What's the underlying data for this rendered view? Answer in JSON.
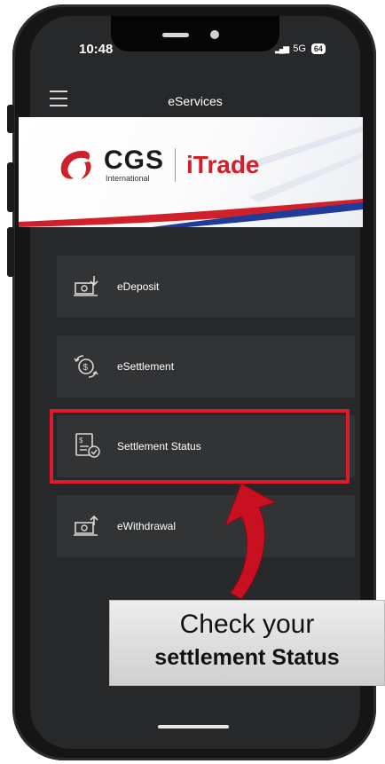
{
  "status_bar": {
    "time": "10:48",
    "network": "5G",
    "battery": "64"
  },
  "header": {
    "title": "eServices"
  },
  "banner": {
    "brand": "CGS",
    "brand_sub": "International",
    "product": "iTrade"
  },
  "menu": [
    {
      "label": "eDeposit",
      "icon": "deposit-icon"
    },
    {
      "label": "eSettlement",
      "icon": "settlement-exchange-icon"
    },
    {
      "label": "Settlement Status",
      "icon": "settlement-status-icon"
    },
    {
      "label": "eWithdrawal",
      "icon": "withdrawal-icon"
    }
  ],
  "callout": {
    "line1": "Check your",
    "line2": "settlement Status"
  },
  "colors": {
    "accent": "#e0182a",
    "screen_bg": "#27282a",
    "card_bg": "#323335",
    "brand_red": "#d0202a"
  }
}
